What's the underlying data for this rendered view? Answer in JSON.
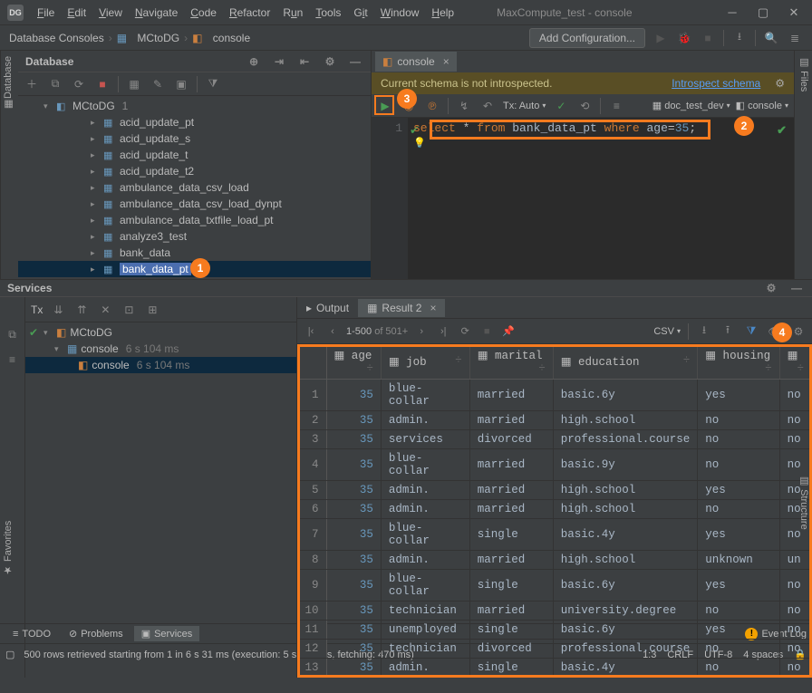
{
  "window": {
    "title": "MaxCompute_test - console",
    "app_abbr": "DG"
  },
  "menu": [
    "File",
    "Edit",
    "View",
    "Navigate",
    "Code",
    "Refactor",
    "Run",
    "Tools",
    "Git",
    "Window",
    "Help"
  ],
  "breadcrumb": {
    "b1": "Database Consoles",
    "b2": "MCtoDG",
    "b3": "console"
  },
  "toolbar": {
    "add_config": "Add Configuration..."
  },
  "side_tabs": {
    "left": "Database",
    "right": "Files",
    "right2": "Structure",
    "favorites": "Favorites"
  },
  "db_panel": {
    "title": "Database",
    "root": "MCtoDG",
    "root_count": "1",
    "items": [
      "acid_update_pt",
      "acid_update_s",
      "acid_update_t",
      "acid_update_t2",
      "ambulance_data_csv_load",
      "ambulance_data_csv_load_dynpt",
      "ambulance_data_txtfile_load_pt",
      "analyze3_test",
      "bank_data",
      "bank_data_pt"
    ]
  },
  "editor": {
    "tab_label": "console",
    "warn": "Current schema is not introspected.",
    "warn_link": "Introspect schema",
    "tx_label": "Tx: Auto",
    "ds_label": "doc_test_dev",
    "con_label": "console",
    "line_no": "1",
    "sql": {
      "select": "select",
      "star": " * ",
      "from": "from",
      "table": " bank_data_pt ",
      "where": "where",
      "cond_col": " age",
      "cond_eq": "=",
      "cond_val": "35",
      "semi": ";"
    }
  },
  "services": {
    "title": "Services",
    "tx": "Tx",
    "root": "MCtoDG",
    "c1": "console",
    "c1_time": "6 s 104 ms",
    "c2": "console",
    "c2_time": "6 s 104 ms"
  },
  "results": {
    "output_tab": "Output",
    "result_tab": "Result 2",
    "pager": {
      "range": "1-500",
      "of": " of 501+"
    },
    "csv": "CSV",
    "columns": [
      "age",
      "job",
      "marital",
      "education",
      "housing",
      ""
    ],
    "rows": [
      {
        "n": "1",
        "age": "35",
        "job": "blue-collar",
        "marital": "married",
        "education": "basic.6y",
        "housing": "yes",
        "last": "no"
      },
      {
        "n": "2",
        "age": "35",
        "job": "admin.",
        "marital": "married",
        "education": "high.school",
        "housing": "no",
        "last": "no"
      },
      {
        "n": "3",
        "age": "35",
        "job": "services",
        "marital": "divorced",
        "education": "professional.course",
        "housing": "no",
        "last": "no"
      },
      {
        "n": "4",
        "age": "35",
        "job": "blue-collar",
        "marital": "married",
        "education": "basic.9y",
        "housing": "no",
        "last": "no"
      },
      {
        "n": "5",
        "age": "35",
        "job": "admin.",
        "marital": "married",
        "education": "high.school",
        "housing": "yes",
        "last": "no"
      },
      {
        "n": "6",
        "age": "35",
        "job": "admin.",
        "marital": "married",
        "education": "high.school",
        "housing": "no",
        "last": "no"
      },
      {
        "n": "7",
        "age": "35",
        "job": "blue-collar",
        "marital": "single",
        "education": "basic.4y",
        "housing": "yes",
        "last": "no"
      },
      {
        "n": "8",
        "age": "35",
        "job": "admin.",
        "marital": "married",
        "education": "high.school",
        "housing": "unknown",
        "last": "un"
      },
      {
        "n": "9",
        "age": "35",
        "job": "blue-collar",
        "marital": "single",
        "education": "basic.6y",
        "housing": "yes",
        "last": "no"
      },
      {
        "n": "10",
        "age": "35",
        "job": "technician",
        "marital": "married",
        "education": "university.degree",
        "housing": "no",
        "last": "no"
      },
      {
        "n": "11",
        "age": "35",
        "job": "unemployed",
        "marital": "single",
        "education": "basic.6y",
        "housing": "yes",
        "last": "no"
      },
      {
        "n": "12",
        "age": "35",
        "job": "technician",
        "marital": "divorced",
        "education": "professional.course",
        "housing": "no",
        "last": "no"
      },
      {
        "n": "13",
        "age": "35",
        "job": "admin.",
        "marital": "single",
        "education": "basic.4y",
        "housing": "no",
        "last": "no"
      }
    ]
  },
  "bottom_tabs": {
    "todo": "TODO",
    "problems": "Problems",
    "services": "Services",
    "event_log": "Event Log"
  },
  "status": {
    "msg": "500 rows retrieved starting from 1 in 6 s 31 ms (execution: 5 s 561 ms, fetching: 470 ms)",
    "lc": "1:3",
    "crlf": "CRLF",
    "enc": "UTF-8",
    "indent": "4 spaces"
  }
}
